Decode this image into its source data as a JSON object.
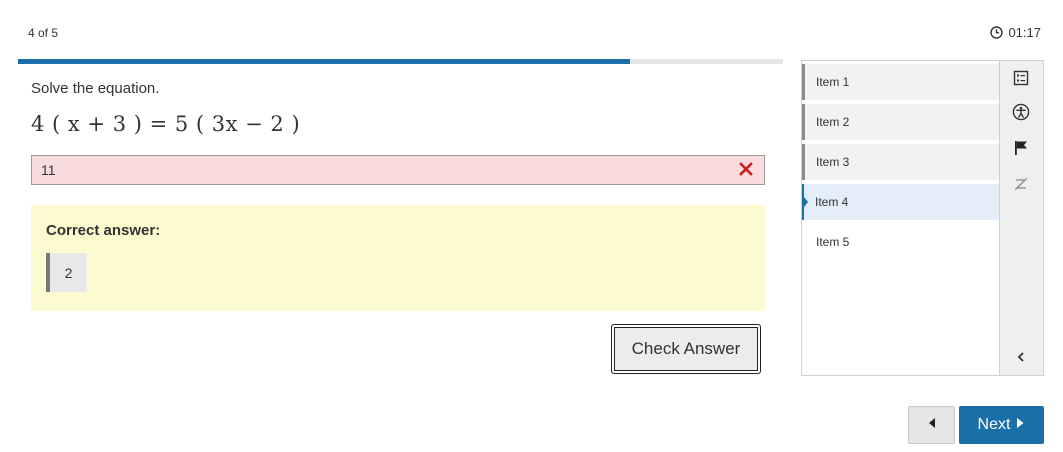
{
  "header": {
    "progress_label": "4 of 5",
    "timer": "01:17",
    "progress_fraction": 0.8
  },
  "question": {
    "prompt": "Solve the equation.",
    "equation": "4 ( x + 3 ) = 5 ( 3x − 2 )",
    "student_answer": "11",
    "answer_state": "incorrect"
  },
  "feedback": {
    "title": "Correct answer:",
    "value": "2"
  },
  "buttons": {
    "check_answer": "Check Answer",
    "next": "Next"
  },
  "sidebar": {
    "items": [
      {
        "label": "Item 1",
        "state": "visited"
      },
      {
        "label": "Item 2",
        "state": "visited"
      },
      {
        "label": "Item 3",
        "state": "visited"
      },
      {
        "label": "Item 4",
        "state": "current"
      },
      {
        "label": "Item 5",
        "state": "unvisited"
      }
    ],
    "tools": [
      "list-icon",
      "accessibility-icon",
      "flag-icon",
      "eraser-icon",
      "chevron-left-icon"
    ]
  },
  "colors": {
    "accent": "#1b6fa8",
    "incorrect_bg": "#f9dbdd",
    "incorrect_mark": "#cc1f1f",
    "feedback_bg": "#fcfbd0"
  }
}
